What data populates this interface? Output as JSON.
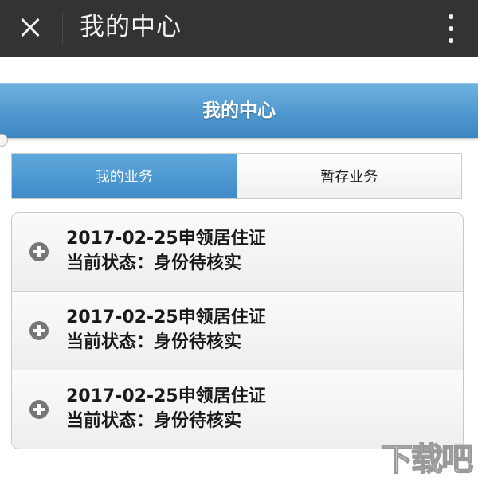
{
  "topbar": {
    "title": "我的中心"
  },
  "header": {
    "title": "我的中心"
  },
  "tabs": [
    {
      "label": "我的业务",
      "active": true
    },
    {
      "label": "暂存业务",
      "active": false
    }
  ],
  "list": {
    "items": [
      {
        "title": "2017-02-25申领居住证",
        "status": "当前状态：身份待核实"
      },
      {
        "title": "2017-02-25申领居住证",
        "status": "当前状态：身份待核实"
      },
      {
        "title": "2017-02-25申领居住证",
        "status": "当前状态：身份待核实"
      }
    ]
  },
  "watermark": {
    "text": "下载吧"
  },
  "icons": {
    "close": "close-icon",
    "more": "more-vertical-icon",
    "expand": "plus-circle-icon"
  },
  "colors": {
    "topbar_bg": "#333334",
    "header_accent": "#4f98cf",
    "active_tab": "#4a97d2"
  }
}
